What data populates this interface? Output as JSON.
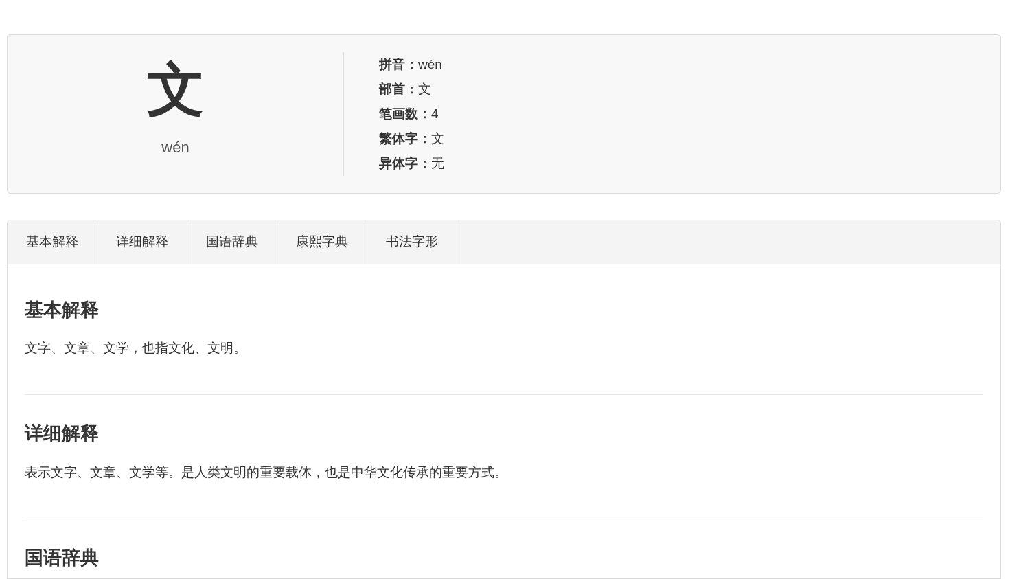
{
  "character": {
    "glyph": "文",
    "pinyin": "wén"
  },
  "info": [
    {
      "label": "拼音：",
      "value": "wén"
    },
    {
      "label": "部首：",
      "value": "文"
    },
    {
      "label": "笔画数：",
      "value": "4"
    },
    {
      "label": "繁体字：",
      "value": "文"
    },
    {
      "label": "异体字：",
      "value": "无"
    }
  ],
  "tabs": [
    {
      "label": "基本解释"
    },
    {
      "label": "详细解释"
    },
    {
      "label": "国语辞典"
    },
    {
      "label": "康熙字典"
    },
    {
      "label": "书法字形"
    }
  ],
  "sections": [
    {
      "title": "基本解释",
      "text": "文字、文章、文学，也指文化、文明。"
    },
    {
      "title": "详细解释",
      "text": "表示文字、文章、文学等。是人类文明的重要载体，也是中华文化传承的重要方式。"
    },
    {
      "title": "国语辞典"
    }
  ]
}
